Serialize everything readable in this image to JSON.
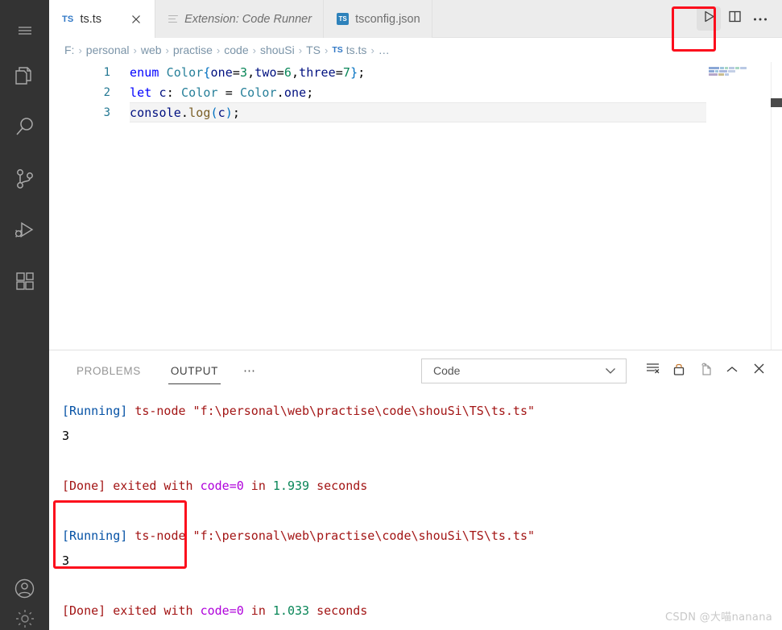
{
  "activity_bar": {
    "items": [
      {
        "name": "menu",
        "icon": "hamburger-menu-icon"
      },
      {
        "name": "explorer",
        "icon": "files-icon"
      },
      {
        "name": "search",
        "icon": "search-icon"
      },
      {
        "name": "source-control",
        "icon": "source-control-icon"
      },
      {
        "name": "run-and-debug",
        "icon": "run-debug-icon"
      },
      {
        "name": "extensions",
        "icon": "extensions-icon"
      }
    ],
    "bottom_items": [
      {
        "name": "accounts",
        "icon": "account-icon"
      },
      {
        "name": "settings",
        "icon": "gear-icon"
      }
    ]
  },
  "tabs": [
    {
      "label": "ts.ts",
      "icon": "ts-file-icon",
      "active": true,
      "italic": false,
      "closable": true
    },
    {
      "label": "Extension: Code Runner",
      "icon": "extension-list-icon",
      "active": false,
      "italic": true,
      "closable": false
    },
    {
      "label": "tsconfig.json",
      "icon": "ts-config-icon",
      "active": false,
      "italic": false,
      "closable": false
    }
  ],
  "tab_actions": [
    {
      "name": "run-code-button",
      "icon": "play-triangle-icon",
      "pressed": true
    },
    {
      "name": "split-editor-button",
      "icon": "split-editor-icon",
      "pressed": false
    },
    {
      "name": "more-actions-button",
      "icon": "ellipsis-icon",
      "pressed": false
    }
  ],
  "breadcrumb": {
    "separator": "›",
    "items": [
      "F:",
      "personal",
      "web",
      "practise",
      "code",
      "shouSi",
      "TS"
    ],
    "file_badge": "TS",
    "file": "ts.ts",
    "trailing": "…"
  },
  "editor": {
    "lines": [
      {
        "number": "1",
        "current": false,
        "tokens": [
          {
            "text": "enum",
            "cls": "kw-blue"
          },
          {
            "text": " ",
            "cls": "punc"
          },
          {
            "text": "Color",
            "cls": "kw-type"
          },
          {
            "text": "{",
            "cls": "var-blue"
          },
          {
            "text": "one",
            "cls": "prop"
          },
          {
            "text": "=",
            "cls": "punc"
          },
          {
            "text": "3",
            "cls": "num"
          },
          {
            "text": ",",
            "cls": "punc"
          },
          {
            "text": "two",
            "cls": "prop"
          },
          {
            "text": "=",
            "cls": "punc"
          },
          {
            "text": "6",
            "cls": "num"
          },
          {
            "text": ",",
            "cls": "punc"
          },
          {
            "text": "three",
            "cls": "prop"
          },
          {
            "text": "=",
            "cls": "punc"
          },
          {
            "text": "7",
            "cls": "num"
          },
          {
            "text": "}",
            "cls": "var-blue"
          },
          {
            "text": ";",
            "cls": "punc"
          }
        ]
      },
      {
        "number": "2",
        "current": false,
        "tokens": [
          {
            "text": "let",
            "cls": "kw-blue"
          },
          {
            "text": " ",
            "cls": "punc"
          },
          {
            "text": "c",
            "cls": "prop"
          },
          {
            "text": ": ",
            "cls": "punc"
          },
          {
            "text": "Color",
            "cls": "kw-type"
          },
          {
            "text": " = ",
            "cls": "punc"
          },
          {
            "text": "Color",
            "cls": "kw-type"
          },
          {
            "text": ".",
            "cls": "punc"
          },
          {
            "text": "one",
            "cls": "prop"
          },
          {
            "text": ";",
            "cls": "punc"
          }
        ]
      },
      {
        "number": "3",
        "current": true,
        "tokens": [
          {
            "text": "console",
            "cls": "prop"
          },
          {
            "text": ".",
            "cls": "punc"
          },
          {
            "text": "log",
            "cls": "fn"
          },
          {
            "text": "(",
            "cls": "var-blue"
          },
          {
            "text": "c",
            "cls": "prop"
          },
          {
            "text": ")",
            "cls": "var-blue"
          },
          {
            "text": ";",
            "cls": "punc"
          }
        ]
      }
    ]
  },
  "panel": {
    "tabs": [
      {
        "label": "PROBLEMS",
        "active": false
      },
      {
        "label": "OUTPUT",
        "active": true
      }
    ],
    "more_label": "⋯",
    "channel_select": {
      "value": "Code",
      "chevron": "chevron-down-icon"
    },
    "actions": [
      {
        "name": "clear-output-button",
        "icon": "clear-output-icon"
      },
      {
        "name": "lock-scroll-button",
        "icon": "lock-icon"
      },
      {
        "name": "open-in-editor-button",
        "icon": "open-in-editor-icon"
      },
      {
        "name": "collapse-panel-button",
        "icon": "chevron-up-icon"
      },
      {
        "name": "close-panel-button",
        "icon": "close-icon"
      }
    ],
    "output_lines": [
      {
        "type": "text",
        "segments": [
          {
            "text": "[Running]",
            "cls": "o-running"
          },
          {
            "text": " ",
            "cls": "o-plain"
          },
          {
            "text": "ts-node \"f:\\personal\\web\\practise\\code\\shouSi\\TS\\ts.ts\"",
            "cls": "o-cmd"
          }
        ]
      },
      {
        "type": "text",
        "segments": [
          {
            "text": "3",
            "cls": "o-val"
          }
        ]
      },
      {
        "type": "blank",
        "segments": []
      },
      {
        "type": "text",
        "segments": [
          {
            "text": "[Done]",
            "cls": "o-done"
          },
          {
            "text": " ",
            "cls": "o-plain"
          },
          {
            "text": "exited with ",
            "cls": "o-cmd"
          },
          {
            "text": "code=0",
            "cls": "o-purple"
          },
          {
            "text": " in ",
            "cls": "o-cmd"
          },
          {
            "text": "1.939",
            "cls": "o-green"
          },
          {
            "text": " seconds",
            "cls": "o-cmd"
          }
        ]
      },
      {
        "type": "blank",
        "segments": []
      },
      {
        "type": "text",
        "segments": [
          {
            "text": "[Running]",
            "cls": "o-running"
          },
          {
            "text": " ",
            "cls": "o-plain"
          },
          {
            "text": "ts-node \"f:\\personal\\web\\practise\\code\\shouSi\\TS\\ts.ts\"",
            "cls": "o-cmd"
          }
        ]
      },
      {
        "type": "text",
        "segments": [
          {
            "text": "3",
            "cls": "o-val"
          }
        ]
      },
      {
        "type": "blank",
        "segments": []
      },
      {
        "type": "text",
        "segments": [
          {
            "text": "[Done]",
            "cls": "o-done"
          },
          {
            "text": " ",
            "cls": "o-plain"
          },
          {
            "text": "exited with ",
            "cls": "o-cmd"
          },
          {
            "text": "code=0",
            "cls": "o-purple"
          },
          {
            "text": " in ",
            "cls": "o-cmd"
          },
          {
            "text": "1.033",
            "cls": "o-green"
          },
          {
            "text": " seconds",
            "cls": "o-cmd"
          }
        ]
      }
    ]
  },
  "annotations": [
    {
      "name": "run-button-highlight",
      "color": "#fc0d1c"
    },
    {
      "name": "output-result-highlight",
      "color": "#fc0d1c"
    }
  ],
  "watermark": {
    "text": "CSDN @大喵nanana"
  },
  "minimap": {
    "rows": [
      [
        {
          "w": 13,
          "c": "#8aa7d6"
        },
        {
          "w": 5,
          "c": "#9ec5de"
        },
        {
          "w": 4,
          "c": "#a8d7c2"
        },
        {
          "w": 7,
          "c": "#b9c9e4"
        },
        {
          "w": 5,
          "c": "#a8d7c2"
        },
        {
          "w": 8,
          "c": "#b9c9e4"
        }
      ],
      [
        {
          "w": 7,
          "c": "#8aa7d6"
        },
        {
          "w": 4,
          "c": "#9ec5de"
        },
        {
          "w": 10,
          "c": "#a9b8de"
        },
        {
          "w": 9,
          "c": "#c3cfe6"
        }
      ],
      [
        {
          "w": 11,
          "c": "#b5a7c9"
        },
        {
          "w": 7,
          "c": "#c9bd8f"
        },
        {
          "w": 5,
          "c": "#b9c9e4"
        }
      ]
    ]
  },
  "colors": {
    "activity_bar_bg": "#333333",
    "tabbar_bg": "#ececec",
    "editor_bg": "#ffffff",
    "accent_red": "#fc0d1c",
    "ts_blue": "#3178c6"
  }
}
